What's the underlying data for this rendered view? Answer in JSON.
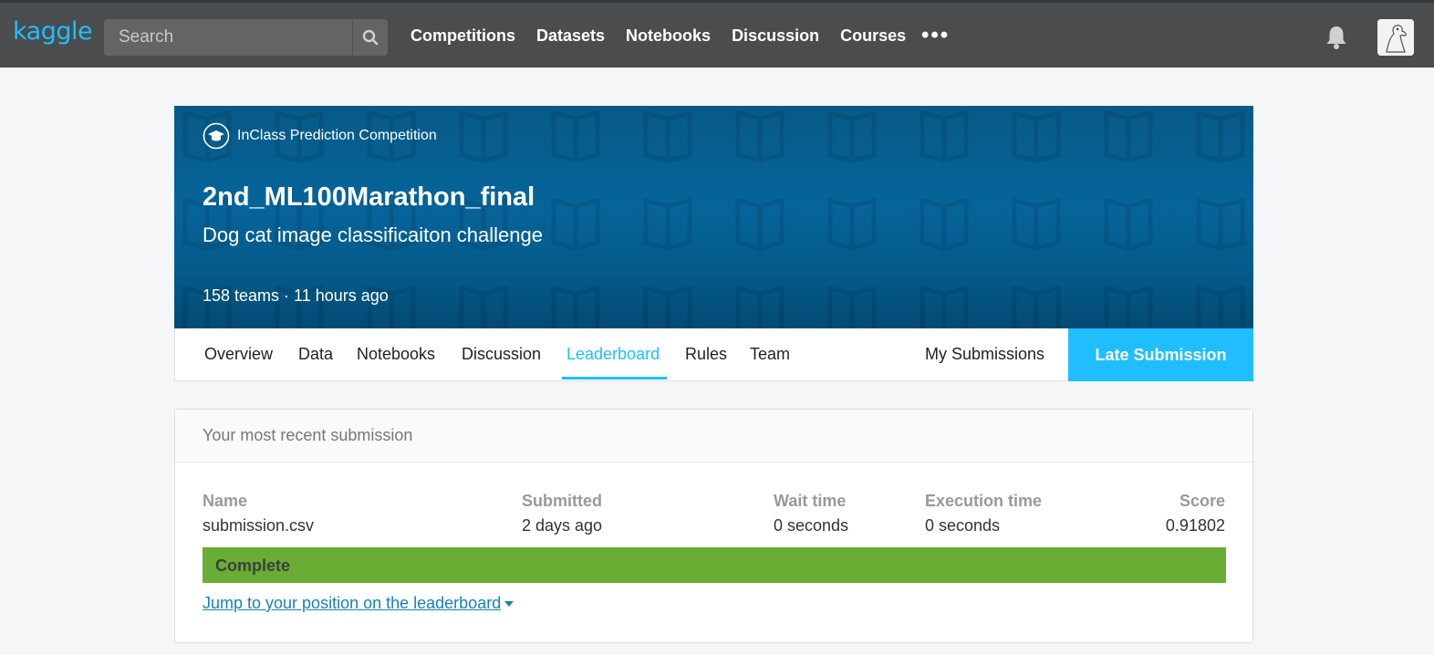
{
  "nav": {
    "logo": "kaggle",
    "search_placeholder": "Search",
    "links": [
      "Competitions",
      "Datasets",
      "Notebooks",
      "Discussion",
      "Courses"
    ],
    "more": "•••"
  },
  "competition": {
    "type": "InClass Prediction Competition",
    "title": "2nd_ML100Marathon_final",
    "subtitle": "Dog cat image classificaiton challenge",
    "meta": "158 teams · 11 hours ago"
  },
  "tabs": {
    "items": [
      "Overview",
      "Data",
      "Notebooks",
      "Discussion",
      "Leaderboard",
      "Rules",
      "Team"
    ],
    "active": "Leaderboard",
    "my_submissions": "My Submissions",
    "late_submission": "Late Submission"
  },
  "submission": {
    "header": "Your most recent submission",
    "columns": {
      "name": {
        "label": "Name",
        "value": "submission.csv"
      },
      "submitted": {
        "label": "Submitted",
        "value": "2 days ago"
      },
      "wait": {
        "label": "Wait time",
        "value": "0 seconds"
      },
      "execution": {
        "label": "Execution time",
        "value": "0 seconds"
      },
      "score": {
        "label": "Score",
        "value": "0.91802"
      }
    },
    "status": "Complete",
    "jump_link": "Jump to your position on the leaderboard"
  },
  "colors": {
    "accent": "#20beff",
    "nav_bg": "#4b4c4e",
    "banner": "#06649a",
    "complete": "#69ad35"
  }
}
